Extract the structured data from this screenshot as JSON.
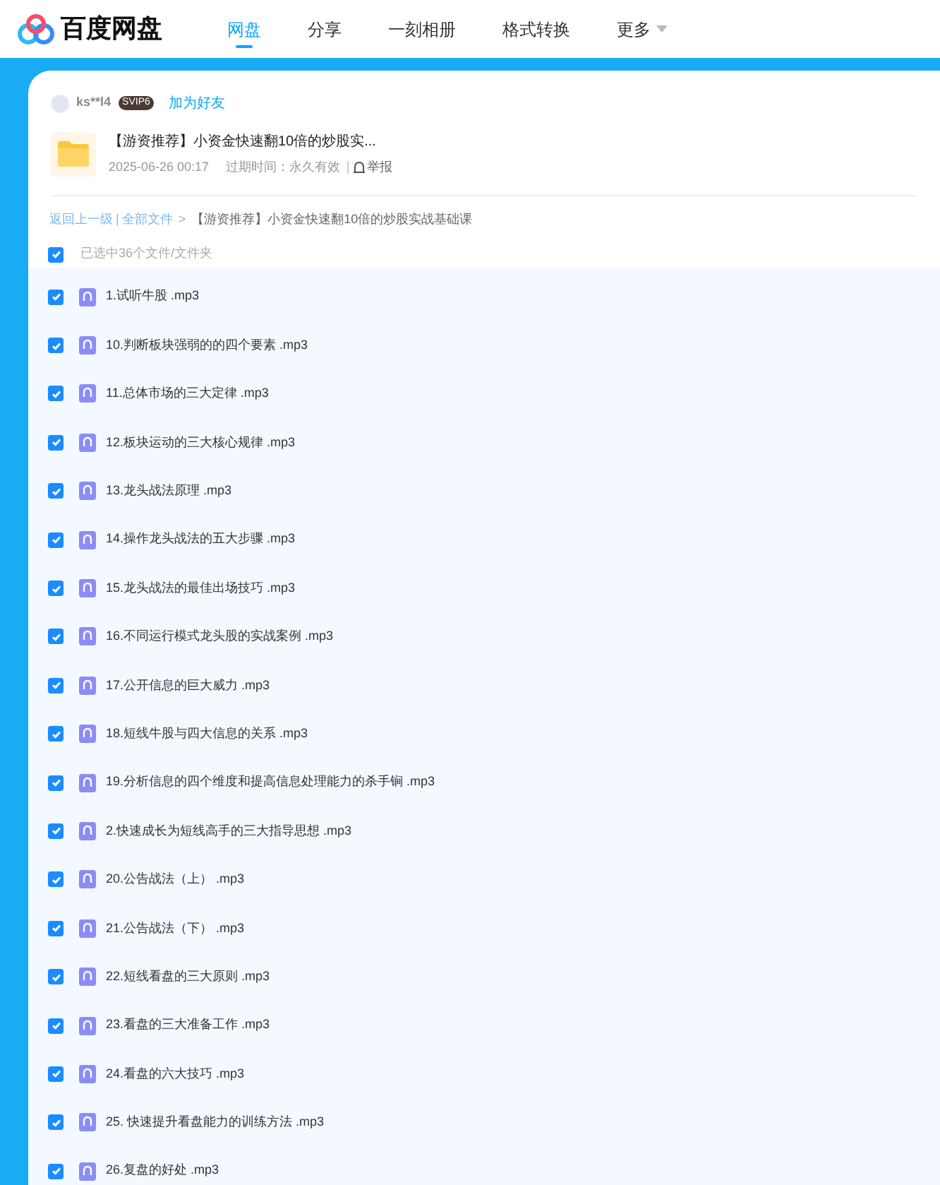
{
  "brand": {
    "name": "百度网盘"
  },
  "nav_tabs": [
    {
      "label": "网盘",
      "selected": true,
      "dropdown": false
    },
    {
      "label": "分享",
      "selected": false,
      "dropdown": false
    },
    {
      "label": "一刻相册",
      "selected": false,
      "dropdown": false
    },
    {
      "label": "格式转换",
      "selected": false,
      "dropdown": false
    },
    {
      "label": "更多",
      "selected": false,
      "dropdown": true
    }
  ],
  "sharer": {
    "name": "ks**l4",
    "badge": "SVIP6",
    "add_friend": "加为好友"
  },
  "share": {
    "title": "【游资推荐】小资金快速翻10倍的炒股实...",
    "date": "2025-06-26 00:17",
    "expiry": "过期时间：永久有效",
    "report": "举报"
  },
  "breadcrumb": {
    "back": "返回上一级",
    "separator": "|",
    "root": "全部文件",
    "arrow": ">",
    "current": "【游资推荐】小资金快速翻10倍的炒股实战基础课"
  },
  "select_all": {
    "checked": true,
    "label": "已选中36个文件/文件夹"
  },
  "files": [
    {
      "name": "1.试听牛股 .mp3",
      "checked": true
    },
    {
      "name": "10.判断板块强弱的的四个要素 .mp3",
      "checked": true
    },
    {
      "name": "11.总体市场的三大定律 .mp3",
      "checked": true
    },
    {
      "name": "12.板块运动的三大核心规律 .mp3",
      "checked": true
    },
    {
      "name": "13.龙头战法原理 .mp3",
      "checked": true
    },
    {
      "name": "14.操作龙头战法的五大步骤 .mp3",
      "checked": true
    },
    {
      "name": "15.龙头战法的最佳出场技巧 .mp3",
      "checked": true
    },
    {
      "name": "16.不同运行模式龙头股的实战案例 .mp3",
      "checked": true
    },
    {
      "name": "17.公开信息的巨大威力 .mp3",
      "checked": true
    },
    {
      "name": "18.短线牛股与四大信息的关系 .mp3",
      "checked": true
    },
    {
      "name": "19.分析信息的四个维度和提高信息处理能力的杀手锏 .mp3",
      "checked": true
    },
    {
      "name": "2.快速成长为短线高手的三大指导思想 .mp3",
      "checked": true
    },
    {
      "name": "20.公告战法（上） .mp3",
      "checked": true
    },
    {
      "name": "21.公告战法（下） .mp3",
      "checked": true
    },
    {
      "name": "22.短线看盘的三大原则 .mp3",
      "checked": true
    },
    {
      "name": "23.看盘的三大准备工作 .mp3",
      "checked": true
    },
    {
      "name": "24.看盘的六大技巧 .mp3",
      "checked": true
    },
    {
      "name": "25. 快速提升看盘能力的训练方法 .mp3",
      "checked": true
    },
    {
      "name": "26.复盘的好处 .mp3",
      "checked": true
    }
  ]
}
